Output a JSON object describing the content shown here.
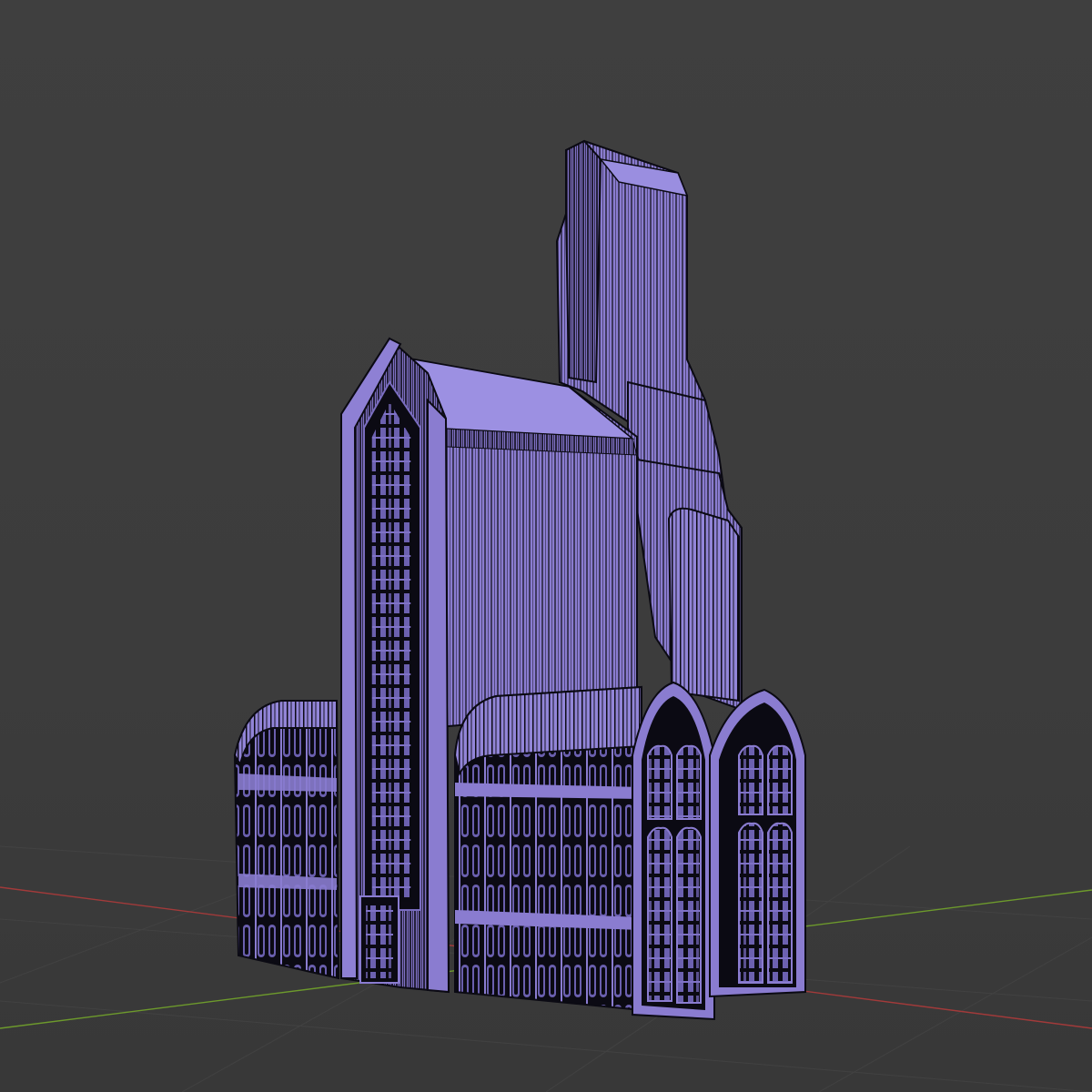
{
  "viewport": {
    "background_color": "#3d3d3d",
    "grid_line_color": "#454545",
    "x_axis_color": "#a23a3a",
    "y_axis_color": "#6d9a2c",
    "shading_mode": "wireframe-on-solid",
    "grid_visible": true
  },
  "model": {
    "object": "gothic-art-deco-tower",
    "solid_color": "#8a7cd0",
    "shadow_color": "#12101e",
    "wire_color": "#0b0a13",
    "parts": [
      "tower-spire",
      "main-hall",
      "entrance-tower",
      "left-side-wing",
      "right-arched-wing",
      "front-arched-gables"
    ]
  }
}
